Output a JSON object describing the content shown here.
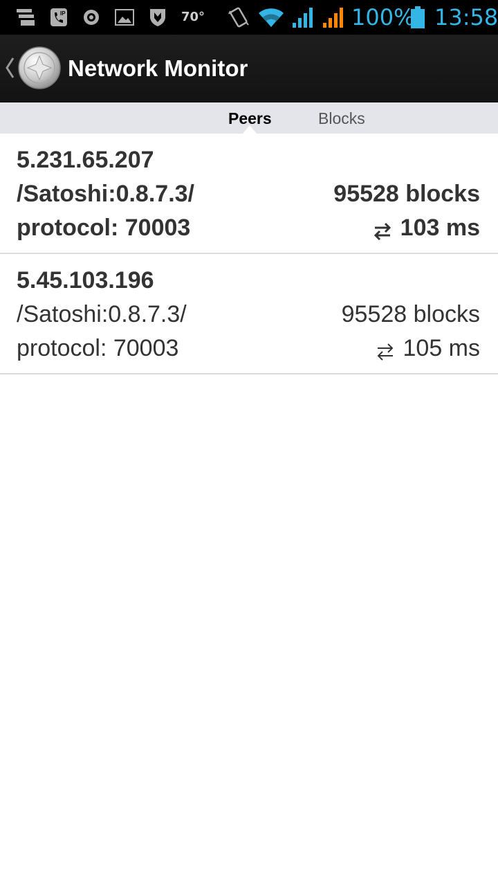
{
  "status_bar": {
    "temperature": "70°",
    "battery_percent": "100%",
    "time": "13:58",
    "icons": [
      "notifications-icon",
      "sip-call-icon",
      "record-icon",
      "image-icon",
      "shield-icon",
      "temperature-icon",
      "vibrate-icon",
      "wifi-icon",
      "signal-blue-icon",
      "signal-orange-icon",
      "battery-icon"
    ],
    "accent_color": "#33b5e5",
    "signal_secondary_color": "#ff8800"
  },
  "action_bar": {
    "title": "Network Monitor",
    "logo_icon": "coin-logo-icon",
    "up_icon": "up-caret-icon"
  },
  "tabs": [
    {
      "label": "Peers",
      "active": true
    },
    {
      "label": "Blocks",
      "active": false
    }
  ],
  "peers": [
    {
      "address": "5.231.65.207",
      "version": "/Satoshi:0.8.7.3/",
      "blocks": "95528 blocks",
      "protocol": "protocol: 70003",
      "ping": "103 ms",
      "highlighted": true
    },
    {
      "address": "5.45.103.196",
      "version": "/Satoshi:0.8.7.3/",
      "blocks": "95528 blocks",
      "protocol": "protocol: 70003",
      "ping": "105 ms",
      "highlighted": false
    }
  ]
}
